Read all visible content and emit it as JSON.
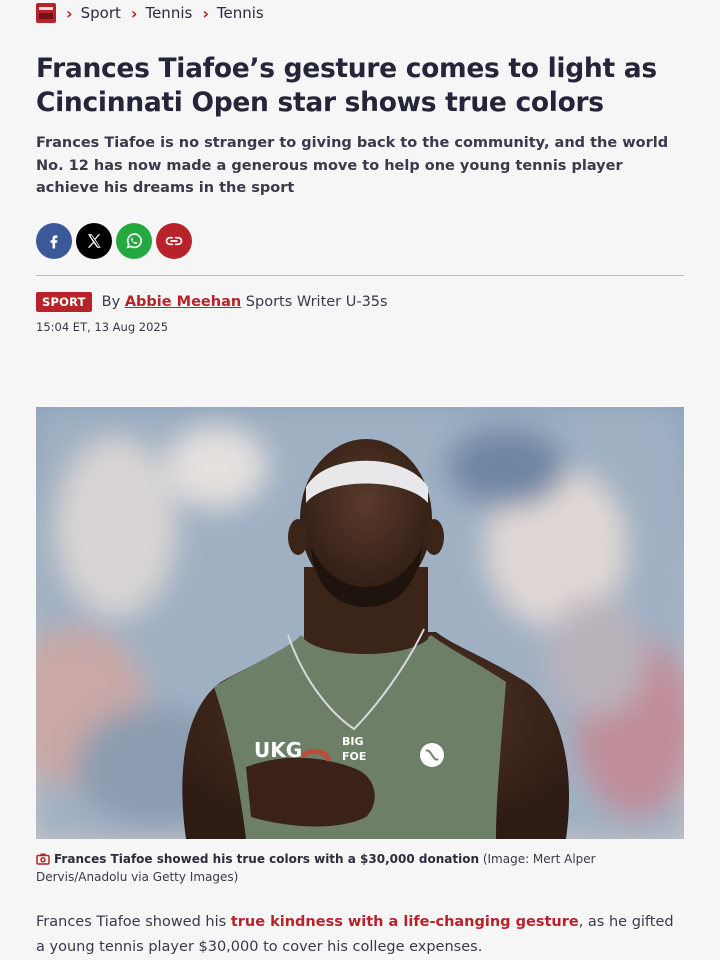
{
  "breadcrumb": {
    "items": [
      "Sport",
      "Tennis",
      "Tennis"
    ]
  },
  "article": {
    "headline": "Frances Tiafoe’s gesture comes to light as Cincinnati Open star shows true colors",
    "standfirst": "Frances Tiafoe is no stranger to giving back to the community, and the world No. 12 has now made a generous move to help one young tennis player achieve his dreams in the sport",
    "share_icons": [
      "facebook-icon",
      "x-icon",
      "whatsapp-icon",
      "link-icon"
    ],
    "tag": "SPORT",
    "by_prefix": "By",
    "author": "Abbie Meehan",
    "author_role": "Sports Writer U-35s",
    "timestamp": "15:04 ET, 13 Aug 2025",
    "image": {
      "shirt_text_1": "UKG",
      "shirt_text_2": "BIG",
      "shirt_text_3": "FOE"
    },
    "caption": "Frances Tiafoe showed his true colors with a $30,000 donation",
    "caption_credit": "(Image: Mert Alper Dervis/Anadolu via Getty Images)",
    "body_pre": "Frances Tiafoe showed his ",
    "body_link": "true kindness with a life-changing gesture",
    "body_post": ", as he gifted a young tennis player $30,000 to cover his college expenses."
  },
  "colors": {
    "accent": "#b8232a",
    "facebook": "#3b5998",
    "x": "#000000",
    "whatsapp": "#23a93f"
  }
}
